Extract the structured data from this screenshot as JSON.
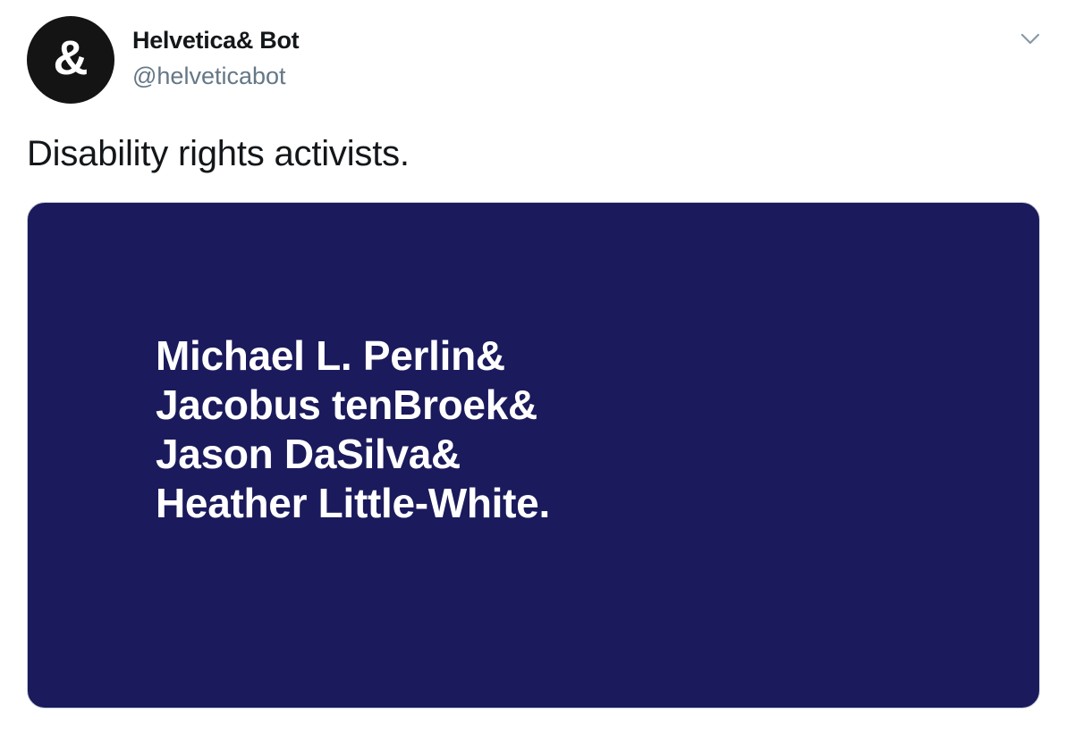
{
  "tweet": {
    "author": {
      "name": "Helvetica& Bot",
      "handle": "@helveticabot",
      "avatar_glyph": "&",
      "avatar_color": "#141414"
    },
    "menu_icon": "chevron-down-icon",
    "text": "Disability rights activists.",
    "media": {
      "background_color": "#1b1a5c",
      "text_color": "#ffffff",
      "lines": [
        "Michael L. Perlin&",
        "Jacobus tenBroek&",
        "Jason DaSilva&",
        "Heather Little-White."
      ]
    }
  }
}
